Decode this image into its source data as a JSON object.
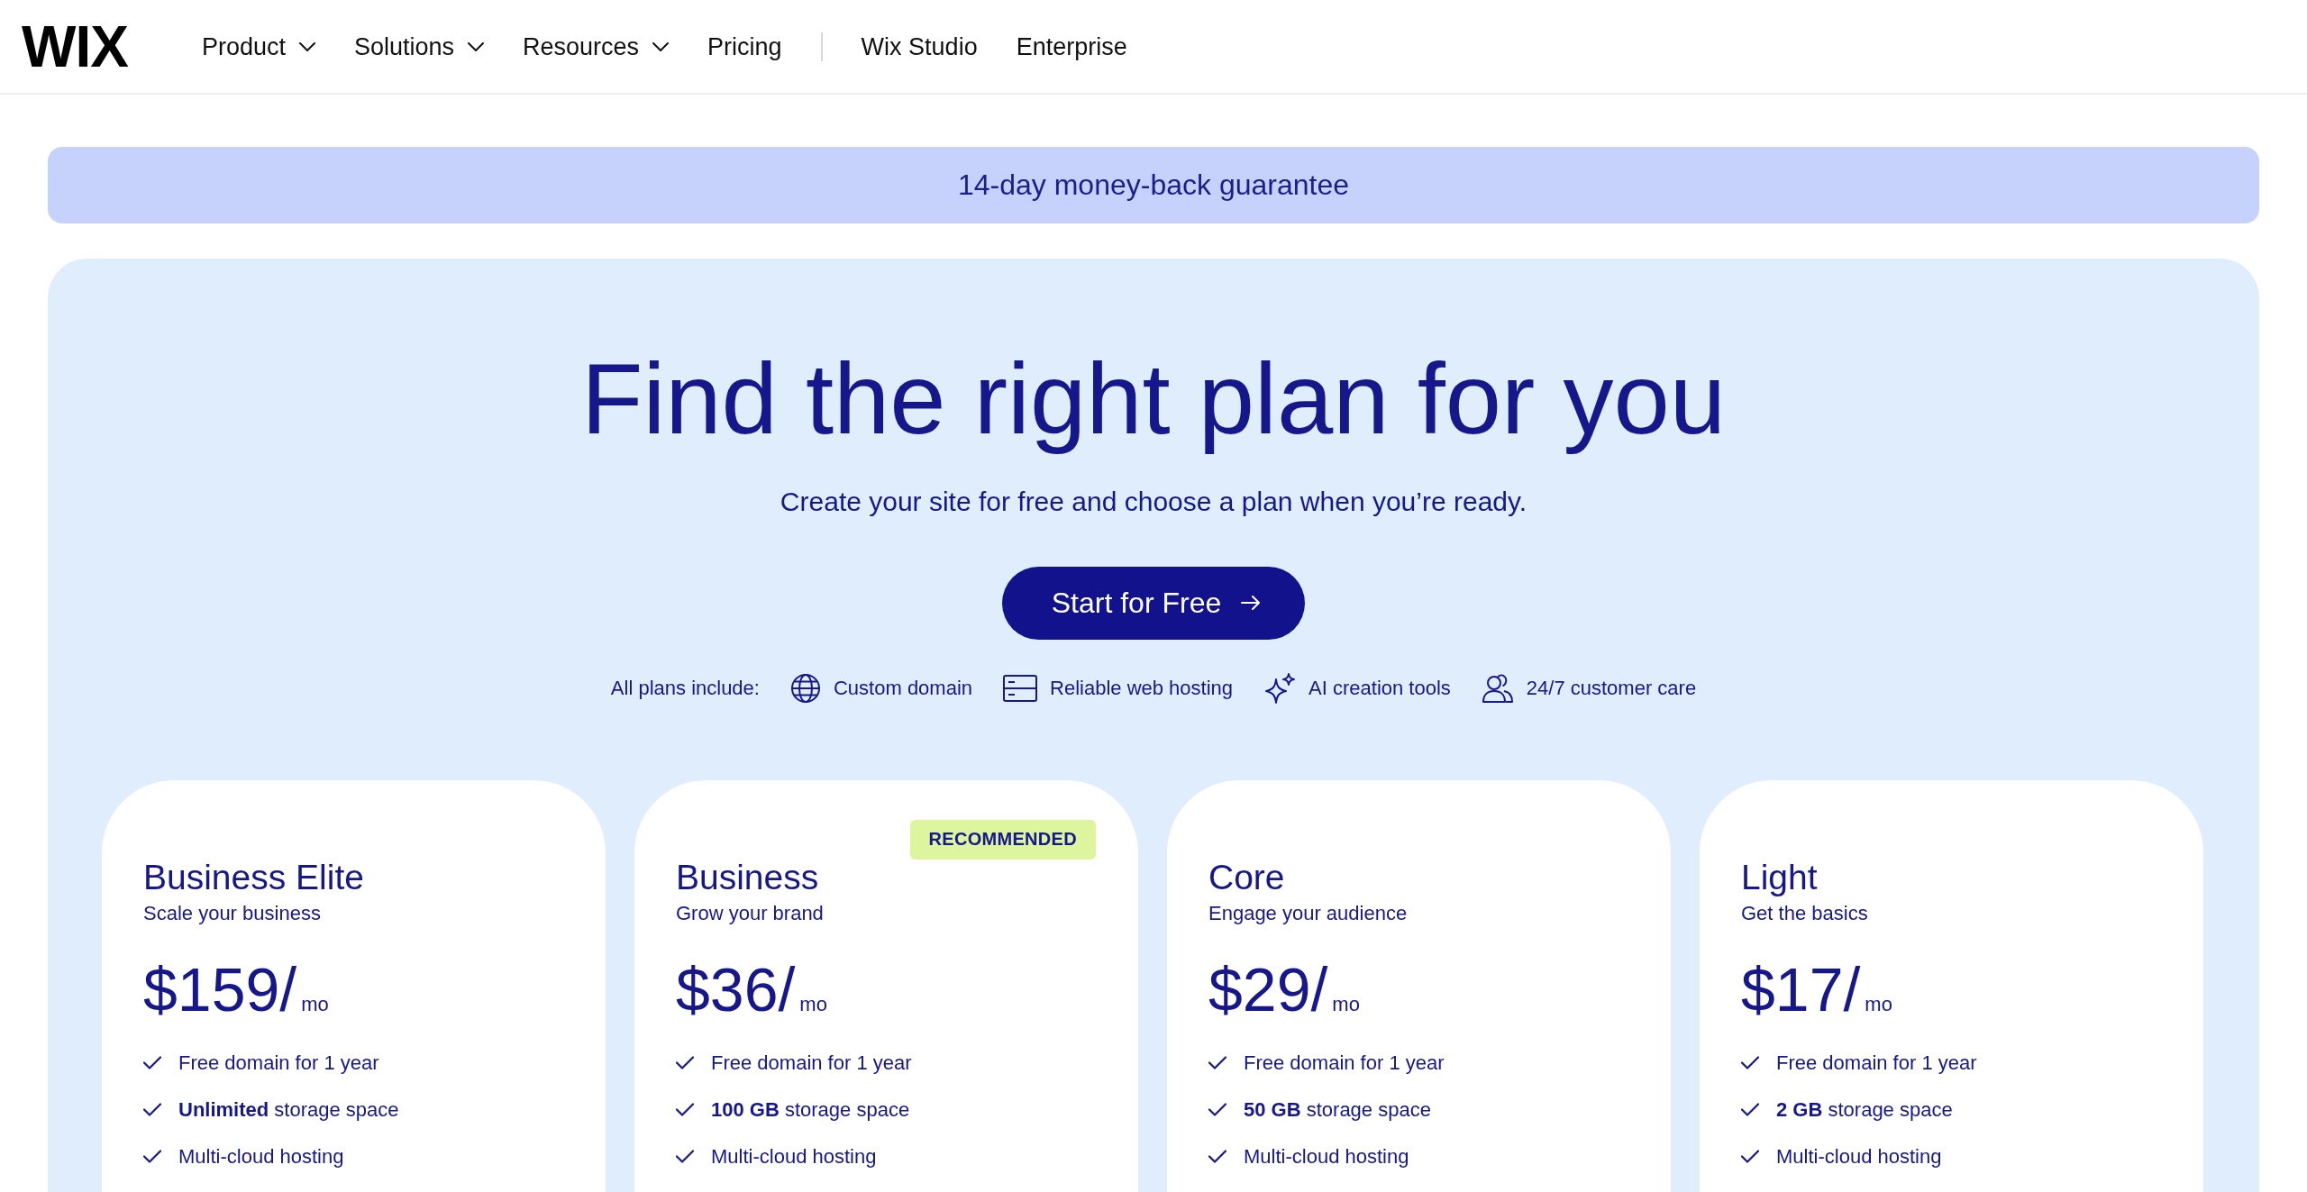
{
  "nav": {
    "logo": "WIX",
    "primary_links": [
      {
        "label": "Product",
        "has_menu": true
      },
      {
        "label": "Solutions",
        "has_menu": true
      },
      {
        "label": "Resources",
        "has_menu": true
      },
      {
        "label": "Pricing",
        "has_menu": false
      }
    ],
    "secondary_links": [
      {
        "label": "Wix Studio",
        "has_menu": false
      },
      {
        "label": "Enterprise",
        "has_menu": false
      }
    ]
  },
  "banner": {
    "text": "14-day money-back guarantee"
  },
  "hero": {
    "title": "Find the right plan for you",
    "subtitle": "Create your site for free and choose a plan when you’re ready.",
    "cta": {
      "label": "Start for Free"
    }
  },
  "included": {
    "label": "All plans include:",
    "items": [
      "Custom domain",
      "Reliable web hosting",
      "AI creation tools",
      "24/7 customer care"
    ]
  },
  "plans": [
    {
      "name": "Business Elite",
      "tagline": "Scale your business",
      "price": "$159/",
      "period": "mo",
      "features": [
        "Free domain for 1 year",
        "**Unlimited** storage space",
        "Multi-cloud hosting"
      ]
    },
    {
      "name": "Business",
      "tagline": "Grow your brand",
      "price": "$36/",
      "period": "mo",
      "badge": "RECOMMENDED",
      "features": [
        "Free domain for 1 year",
        "**100 GB** storage space",
        "Multi-cloud hosting"
      ]
    },
    {
      "name": "Core",
      "tagline": "Engage your audience",
      "price": "$29/",
      "period": "mo",
      "features": [
        "Free domain for 1 year",
        "**50 GB** storage space",
        "Multi-cloud hosting"
      ]
    },
    {
      "name": "Light",
      "tagline": "Get the basics",
      "price": "$17/",
      "period": "mo",
      "features": [
        "Free domain for 1 year",
        "**2 GB** storage space",
        "Multi-cloud hosting"
      ]
    }
  ]
}
